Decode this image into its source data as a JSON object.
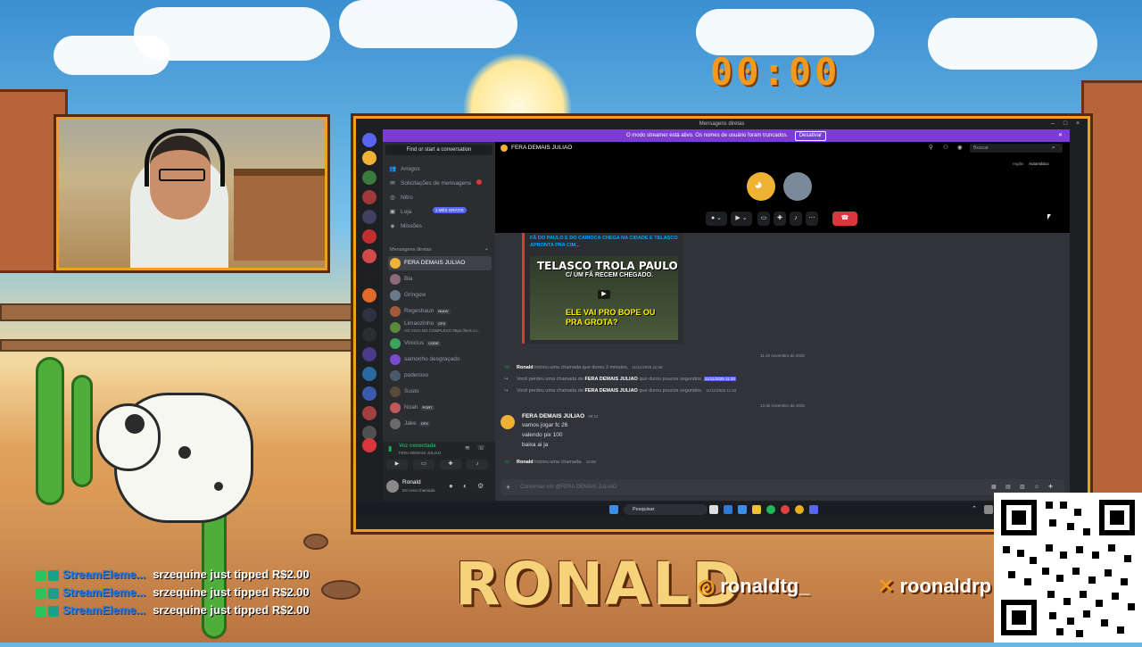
{
  "overlay": {
    "timer": "00:00",
    "brand": "RONALD",
    "instagram": "ronaldtg_",
    "x_handle": "roonaldrp",
    "tips": [
      {
        "source": "StreamEleme...",
        "text": "srzequine just tipped R$2.00"
      },
      {
        "source": "StreamEleme...",
        "text": "srzequine just tipped R$2.00"
      },
      {
        "source": "StreamEleme...",
        "text": "srzequine just tipped R$2.00"
      }
    ]
  },
  "window": {
    "title": "Mensagens diretas",
    "streamer_banner": "O modo streamer está ativo. Os nomes de usuário foram truncados.",
    "banner_button": "Desativar"
  },
  "sidebar": {
    "search": "Find or start a conversation",
    "nav": [
      {
        "icon": "friends-icon",
        "label": "Amigos"
      },
      {
        "icon": "mail-icon",
        "label": "Solicitações de mensagens"
      },
      {
        "icon": "nitro-icon",
        "label": "Nitro",
        "badge": "1 MÊS GRÁTIS"
      },
      {
        "icon": "shop-icon",
        "label": "Loja"
      },
      {
        "icon": "quest-icon",
        "label": "Missões"
      }
    ],
    "section_header": "Mensagens diretas",
    "dms": [
      {
        "name": "FERA DEMAIS JULIAO",
        "color": "#f0b232"
      },
      {
        "name": "Bia",
        "color": "#8c6a7a"
      },
      {
        "name": "Gringow",
        "color": "#6a7a8a"
      },
      {
        "name": "Regeshaun",
        "tag": "NUUV",
        "color": "#a35a3a"
      },
      {
        "name": "Limaozinho",
        "tag": "CFX",
        "sub": "AO VIVO NO COMPLEXO https://kick.co...",
        "color": "#5a8a3a"
      },
      {
        "name": "Vinicius",
        "tag": "CODE",
        "color": "#3aa55a"
      },
      {
        "name": "samonho desgraçado",
        "color": "#7a4ad0"
      },
      {
        "name": "poderoso",
        "color": "#4a5a6a"
      },
      {
        "name": "Susto",
        "color": "#5a4a3a"
      },
      {
        "name": "Noah",
        "tag": "PORT",
        "color": "#c05a5a"
      },
      {
        "name": "Jake",
        "tag": "CFX",
        "color": "#6a6a6a"
      }
    ],
    "voice_status": "Voz conectada",
    "voice_channel": "FERA DEMAIS JULIAO",
    "user_name": "Ronald",
    "user_status": "Em uma chamada"
  },
  "channel": {
    "name": "FERA DEMAIS JULIAO",
    "search_placeholder": "Buscar",
    "region_label": "região",
    "region_value": "Automático"
  },
  "embed": {
    "title": "FÃ DO PAULO E DO CARIOCA CHEGA NA CIDADE E TELASCO APRONTA PRA CIM...",
    "headline1": "TELASCO TROLA PAULO",
    "headline2": "C/ UM FÃ RECEM CHEGADO.",
    "headline3": "ELE VAI PRO BOPE OU PRA GROTA?"
  },
  "messages": {
    "date1": "11 de novembro de 2025",
    "call1_user": "Ronald",
    "call1_text": "iniciou uma chamada que durou 2 minutos.",
    "call1_ts": "11/11/2025 11:06",
    "missed1_pre": "Você perdeu uma chamada de",
    "missed1_user": "FERA DEMAIS JULIAO",
    "missed1_post": "que durou poucos segundos.",
    "missed1_ts": "11/11/2025 11:20",
    "missed2_pre": "Você perdeu uma chamada de",
    "missed2_user": "FERA DEMAIS JULIAO",
    "missed2_post": "que durou poucos segundos.",
    "missed2_ts": "11/11/2025 11:22",
    "date2": "13 de novembro de 2025",
    "author": "FERA DEMAIS JULIAO",
    "author_ts": "09:14",
    "lines": [
      "vamos jogar fc 26",
      "valendo pix 100",
      "baixa ai ja"
    ],
    "call2_user": "Ronald",
    "call2_text": "iniciou uma chamada.",
    "call2_ts": "10:00",
    "composer_placeholder": "Conversar em @FERA DEMAIS JULIAO"
  },
  "taskbar": {
    "search": "Pesquisar"
  },
  "colors": {
    "accent_orange": "#f0a020",
    "discord_blurple": "#5865f2",
    "streamer_purple": "#7d3bd6",
    "hangup_red": "#da373c"
  }
}
